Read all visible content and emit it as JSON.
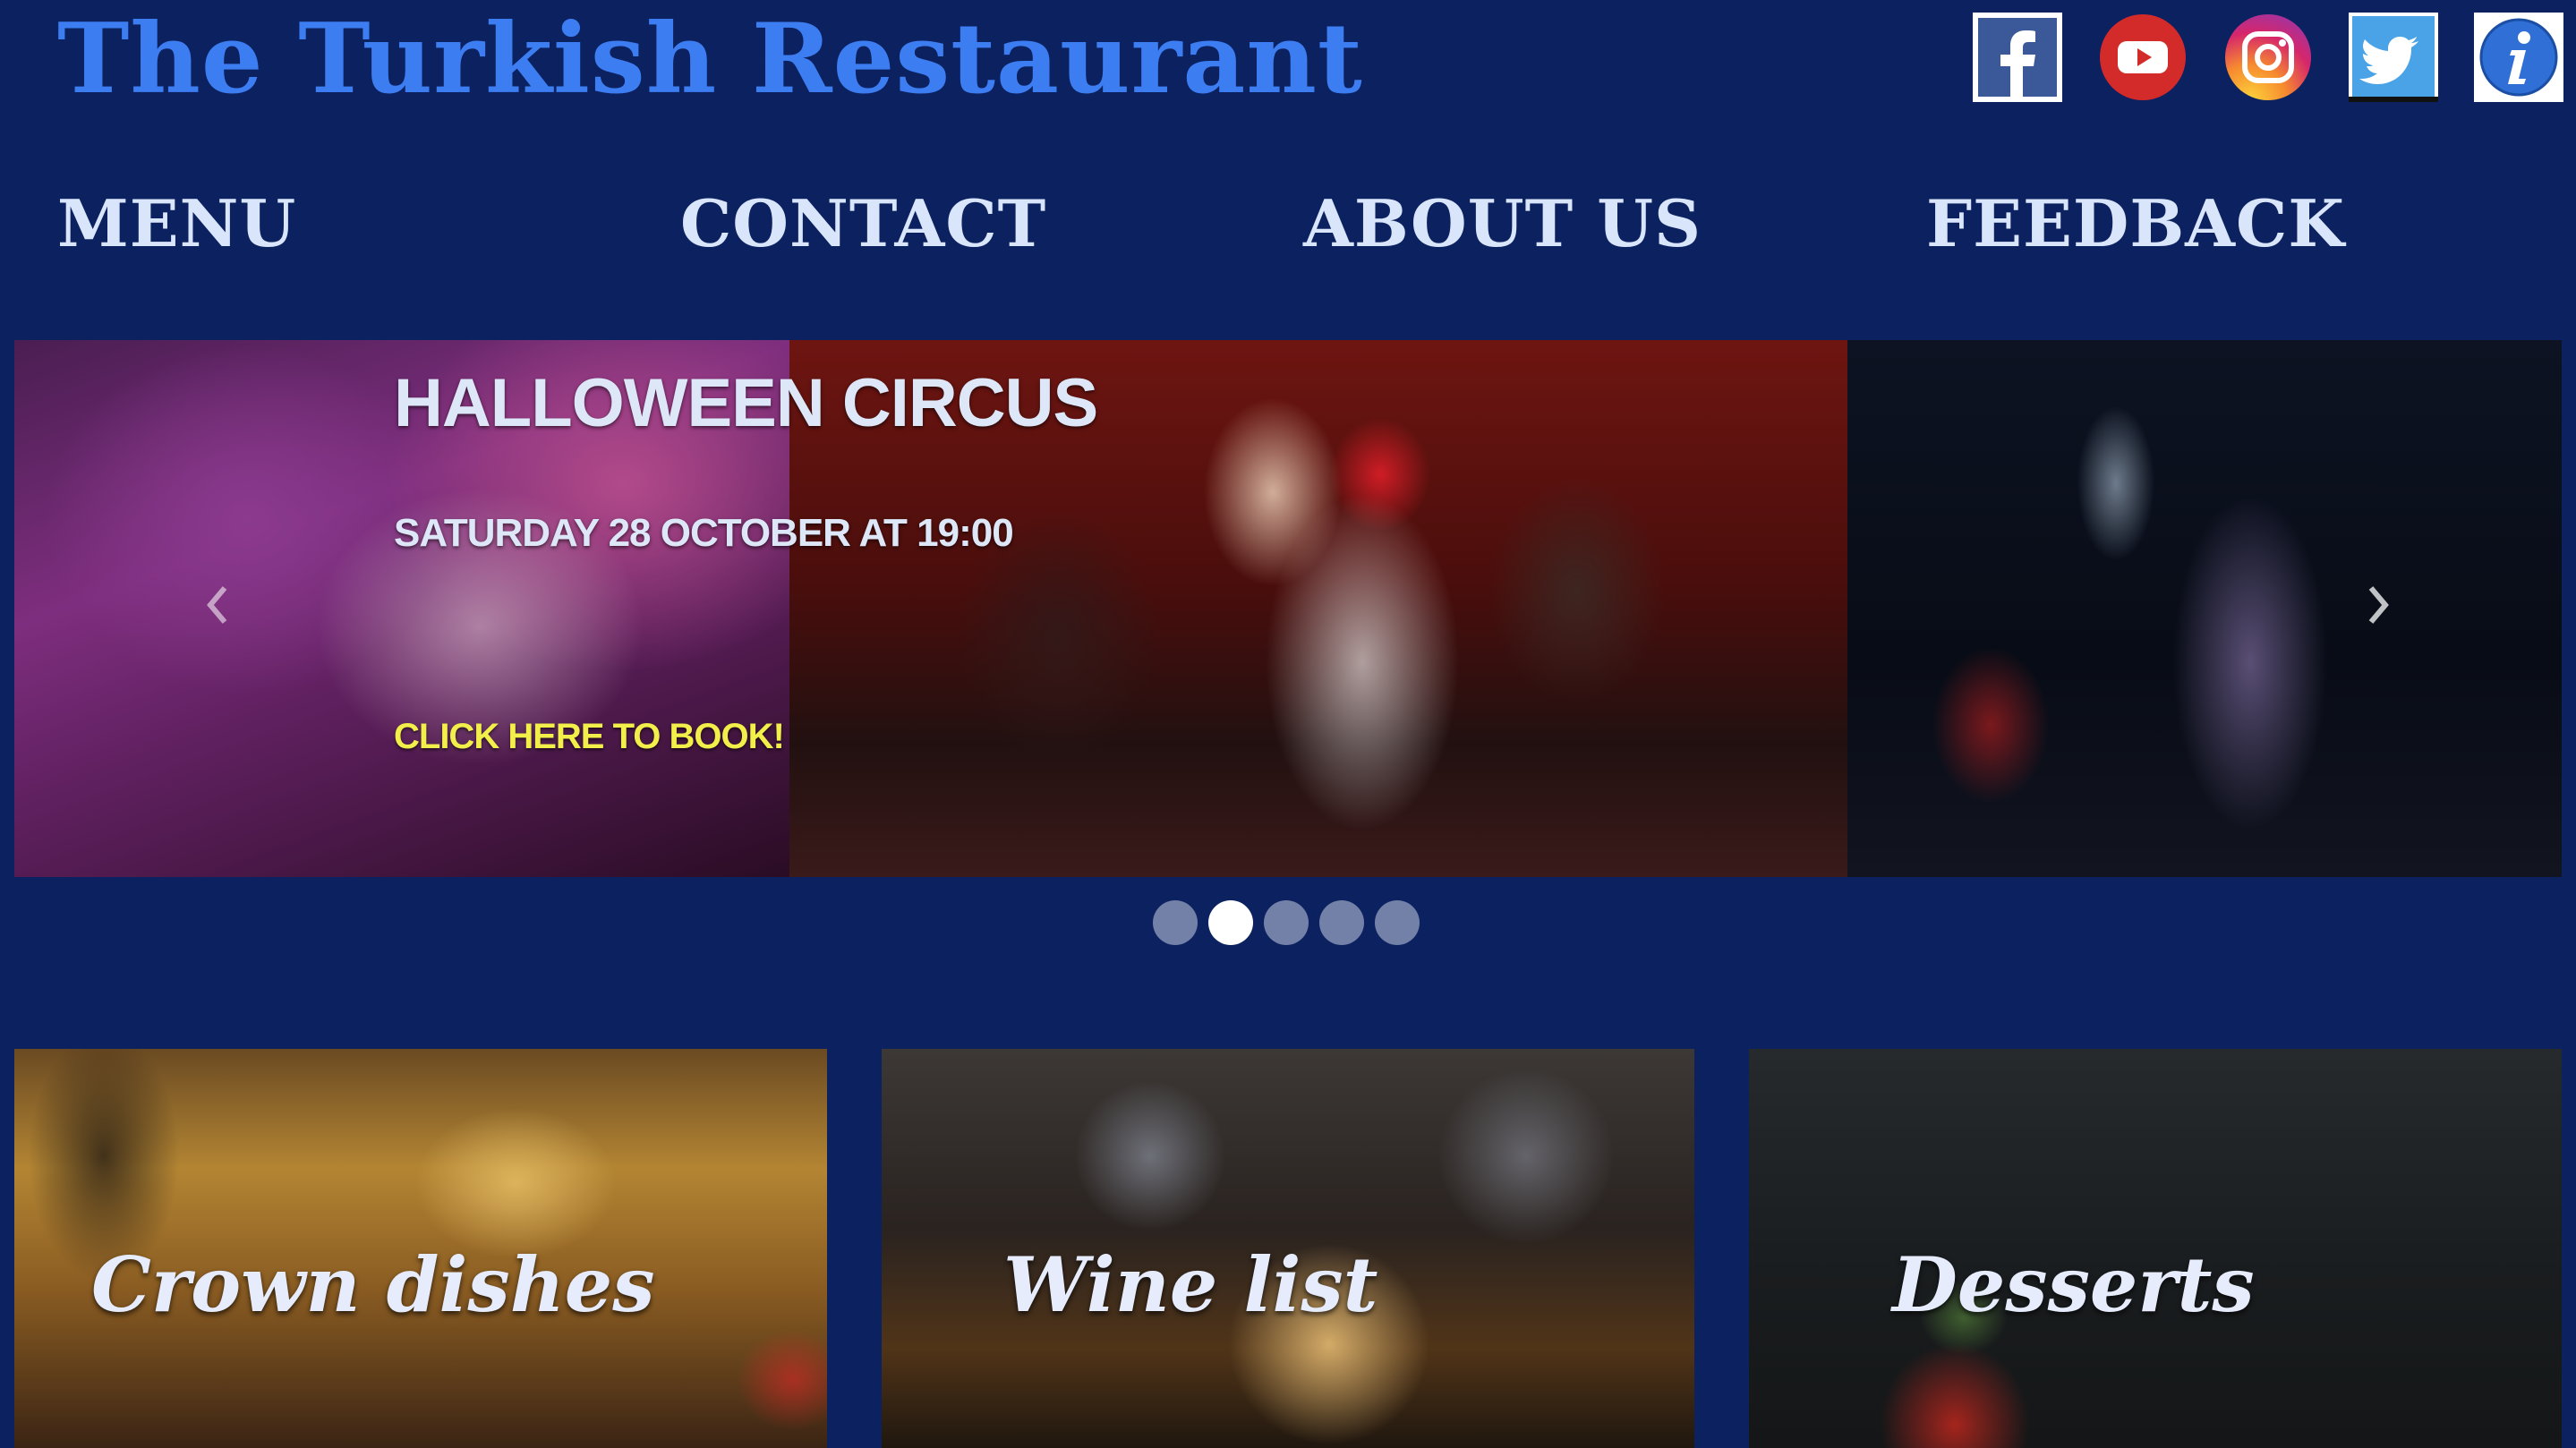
{
  "site": {
    "title": "The Turkish Restaurant"
  },
  "social": [
    {
      "name": "facebook-icon"
    },
    {
      "name": "youtube-icon"
    },
    {
      "name": "instagram-icon"
    },
    {
      "name": "twitter-icon"
    },
    {
      "name": "info-icon"
    }
  ],
  "nav": {
    "items": [
      {
        "label": "MENU"
      },
      {
        "label": "CONTACT"
      },
      {
        "label": "ABOUT US"
      },
      {
        "label": "FEEDBACK"
      }
    ]
  },
  "carousel": {
    "title": "HALLOWEEN CIRCUS",
    "date": "SATURDAY 28 OCTOBER AT 19:00",
    "cta": "CLICK HERE TO BOOK!",
    "slide_count": 5,
    "active_slide": 2
  },
  "cards": [
    {
      "label": "Crown dishes"
    },
    {
      "label": "Wine list"
    },
    {
      "label": "Desserts"
    }
  ],
  "colors": {
    "background": "#0c215f",
    "title": "#3d7df2",
    "nav_text": "#d9e5fb",
    "cta": "#f2ee4a"
  }
}
